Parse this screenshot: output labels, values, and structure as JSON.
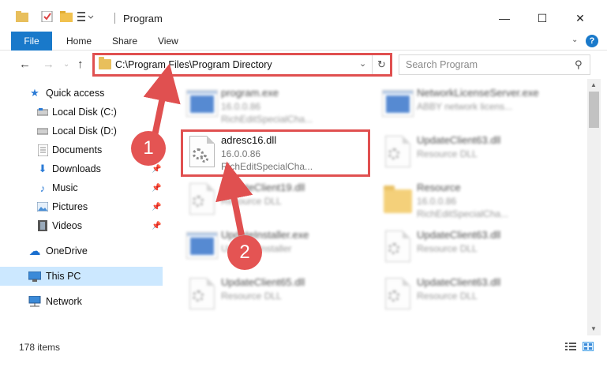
{
  "window": {
    "title": "Program",
    "minimize": "—",
    "maximize": "☐",
    "close": "✕"
  },
  "ribbon": {
    "file": "File",
    "tabs": [
      "Home",
      "Share",
      "View"
    ],
    "help": "?"
  },
  "nav": {
    "back": "←",
    "forward": "→",
    "up": "↑",
    "address": "C:\\Program Files\\Program Directory",
    "search_placeholder": "Search Program"
  },
  "sidebar": {
    "quick_access": "Quick access",
    "items": [
      {
        "label": "Local Disk (C:)",
        "icon": "drive-icon",
        "pinned": false
      },
      {
        "label": "Local Disk (D:)",
        "icon": "drive-icon",
        "pinned": false
      },
      {
        "label": "Documents",
        "icon": "documents-icon",
        "pinned": true
      },
      {
        "label": "Downloads",
        "icon": "downloads-icon",
        "pinned": true
      },
      {
        "label": "Music",
        "icon": "music-icon",
        "pinned": true
      },
      {
        "label": "Pictures",
        "icon": "pictures-icon",
        "pinned": true
      },
      {
        "label": "Videos",
        "icon": "videos-icon",
        "pinned": true
      }
    ],
    "onedrive": "OneDrive",
    "this_pc": "This PC",
    "network": "Network"
  },
  "files": [
    {
      "name": "program.exe",
      "line1": "16.0.0.86",
      "line2": "RichEditSpecialCha...",
      "type": "exe",
      "blurred": true
    },
    {
      "name": "NetworkLicenseServer.exe",
      "line1": "ABBY network licens...",
      "line2": "",
      "type": "exe",
      "blurred": true
    },
    {
      "name": "adresc16.dll",
      "line1": "16.0.0.86",
      "line2": "RichEditSpecialCha...",
      "type": "dll",
      "blurred": false
    },
    {
      "name": "UpdateClient63.dll",
      "line1": "Resource DLL",
      "line2": "",
      "type": "dll",
      "blurred": true
    },
    {
      "name": "UpdateClient19.dll",
      "line1": "Resource DLL",
      "line2": "",
      "type": "dll",
      "blurred": true
    },
    {
      "name": "Resource",
      "line1": "16.0.0.86",
      "line2": "RichEditSpecialCha...",
      "type": "folder",
      "blurred": true
    },
    {
      "name": "UpdateInstaller.exe",
      "line1": "Updates installer",
      "line2": "",
      "type": "exe",
      "blurred": true
    },
    {
      "name": "UpdateClient63.dll",
      "line1": "Resource DLL",
      "line2": "",
      "type": "dll",
      "blurred": true
    },
    {
      "name": "UpdateClient65.dll",
      "line1": "Resource DLL",
      "line2": "",
      "type": "dll",
      "blurred": true
    },
    {
      "name": "UpdateClient63.dll",
      "line1": "Resource DLL",
      "line2": "",
      "type": "dll",
      "blurred": true
    }
  ],
  "status": {
    "count": "178 items"
  },
  "annotations": {
    "step1": "1",
    "step2": "2",
    "color": "#e05050"
  }
}
